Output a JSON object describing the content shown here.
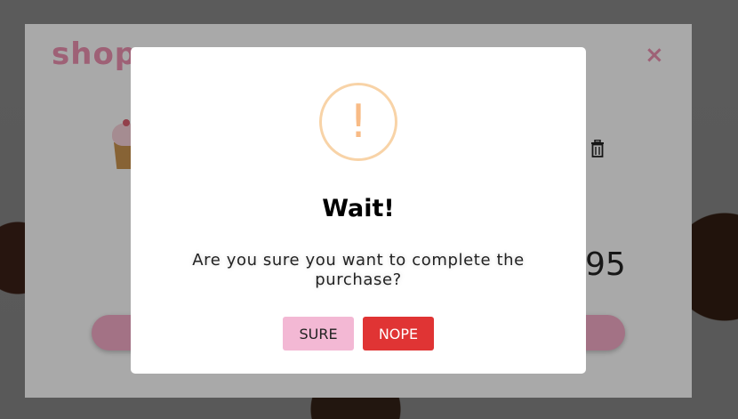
{
  "background": {
    "top_left_text": "",
    "top_center_text": "",
    "top_right_text": ""
  },
  "cart": {
    "logo_text": "shop",
    "close_label": "×",
    "price_fragment": "95",
    "accent_color": "#e98fae"
  },
  "alert": {
    "icon_glyph": "!",
    "title": "Wait!",
    "message": "Are you sure you want to complete the purchase?",
    "confirm_label": "SURE",
    "cancel_label": "NOPE",
    "confirm_color": "#f3b8d4",
    "cancel_color": "#e03434",
    "icon_color": "#f8bb86"
  }
}
